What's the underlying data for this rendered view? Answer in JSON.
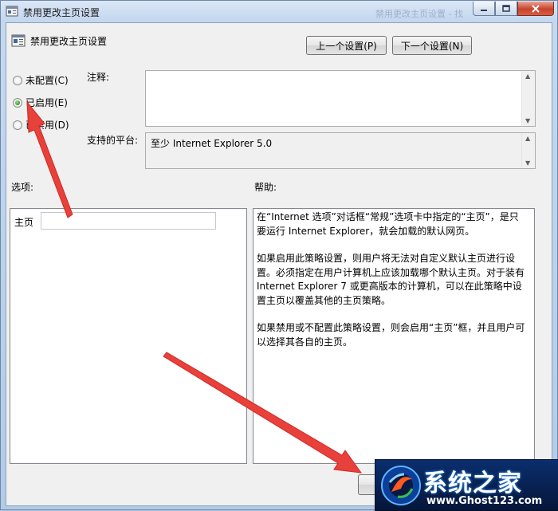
{
  "window": {
    "title": "禁用更改主页设置",
    "background_title": "禁用更改主页设置 - 找"
  },
  "policy": {
    "name": "禁用更改主页设置"
  },
  "nav": {
    "prev_label": "上一个设置(P)",
    "next_label": "下一个设置(N)"
  },
  "state": {
    "options": [
      {
        "label": "未配置(C)",
        "checked": false
      },
      {
        "label": "已启用(E)",
        "checked": true
      },
      {
        "label": "已禁用(D)",
        "checked": false
      }
    ]
  },
  "comment": {
    "label": "注释:",
    "value": ""
  },
  "platform": {
    "label": "支持的平台:",
    "value": "至少 Internet Explorer 5.0"
  },
  "options_section": {
    "label": "选项:",
    "home_label": "主页",
    "home_value": ""
  },
  "help_section": {
    "label": "帮助:",
    "paragraphs": [
      "在“Internet 选项”对话框“常规”选项卡中指定的“主页”，是只要运行 Internet Explorer，就会加载的默认网页。",
      "如果启用此策略设置，则用户将无法对自定义默认主页进行设置。必须指定在用户计算机上应该加载哪个默认主页。对于装有 Internet Explorer 7 或更高版本的计算机，可以在此策略中设置主页以覆盖其他的主页策略。",
      "如果禁用或不配置此策略设置，则会启用“主页”框，并且用户可以选择其各自的主页。"
    ]
  },
  "watermark": {
    "title": "系统之家",
    "url": "www.Ghost123.com"
  },
  "colors": {
    "annotation_arrow": "#e8403a",
    "title_bar": "#c6d9ef",
    "close_button": "#c8432b"
  }
}
